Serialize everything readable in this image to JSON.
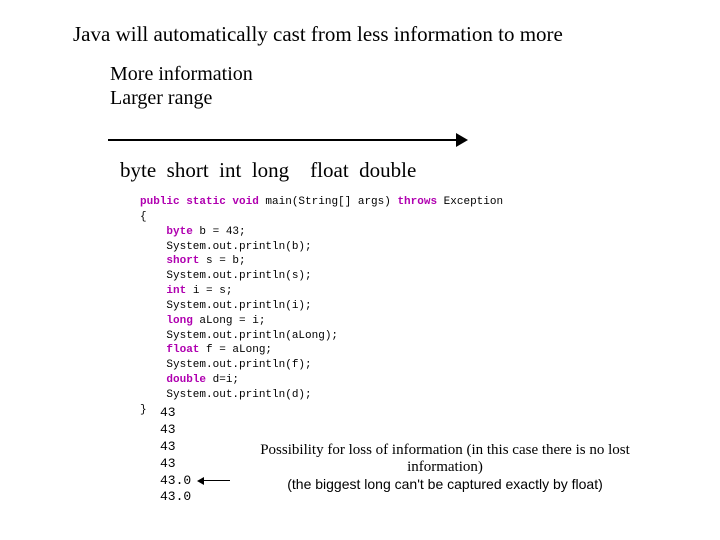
{
  "title": "Java will automatically cast from less information to more",
  "subtitle_line1": "More information",
  "subtitle_line2": "Larger range",
  "types": {
    "byte": "byte",
    "short": "short",
    "int": "int",
    "long": "long",
    "float": "float",
    "double": "double"
  },
  "code": {
    "l0_kw": "public static void",
    "l0_rest": " main(String[] args) ",
    "l0_kw2": "throws",
    "l0_rest2": " Exception",
    "l1": "{",
    "l2_kw": "byte",
    "l2_rest": " b = 43;",
    "l3": "System.out.println(b);",
    "l4_kw": "short",
    "l4_rest": " s = b;",
    "l5": "System.out.println(s);",
    "l6_kw": "int",
    "l6_rest": " i = s;",
    "l7": "System.out.println(i);",
    "l8_kw": "long",
    "l8_rest": " aLong = i;",
    "l9": "System.out.println(aLong);",
    "l10_kw": "float",
    "l10_rest": " f = aLong;",
    "l11": "System.out.println(f);",
    "l12_kw": "double",
    "l12_rest": " d=i;",
    "l13": "System.out.println(d);",
    "l14": "}"
  },
  "output": {
    "o1": "43",
    "o2": "43",
    "o3": "43",
    "o4": "43",
    "o5": "43.0",
    "o6": "43.0"
  },
  "note": {
    "line1": "Possibility for loss of information (in this case there is no lost information)",
    "line2": "(the biggest long can't be captured exactly by float)"
  }
}
